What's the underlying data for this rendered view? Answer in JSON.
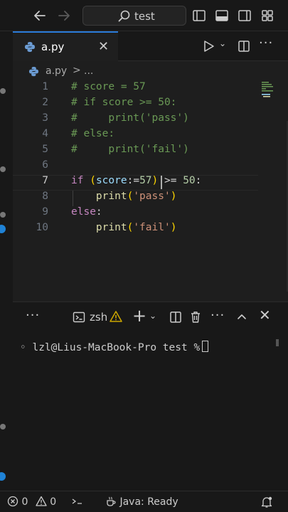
{
  "titlebar": {
    "search_text": "test"
  },
  "tab": {
    "filename": "a.py"
  },
  "breadcrumb": {
    "file": "a.py",
    "separator": ">",
    "more": "..."
  },
  "editor": {
    "active_line": 7,
    "lines": [
      {
        "number": "1",
        "text": "# score = 57"
      },
      {
        "number": "2",
        "text": "# if score >= 50:"
      },
      {
        "number": "3",
        "text": "#     print('pass')"
      },
      {
        "number": "4",
        "text": "# else:"
      },
      {
        "number": "5",
        "text": "#     print('fail')"
      },
      {
        "number": "6",
        "text": ""
      },
      {
        "number": "7",
        "text": "if (score:=57) >= 50:"
      },
      {
        "number": "8",
        "text": "    print('pass')"
      },
      {
        "number": "9",
        "text": "else:"
      },
      {
        "number": "10",
        "text": "    print('fail')"
      }
    ]
  },
  "terminal": {
    "shell_name": "zsh",
    "prompt": "lzl@Lius-MacBook-Pro test %"
  },
  "statusbar": {
    "errors": "0",
    "warnings": "0",
    "java_status": "Java: Ready"
  },
  "colors": {
    "accent": "#2a7ad8",
    "comment": "#6a9955",
    "keyword": "#c586c0",
    "function": "#dcdcaa",
    "string": "#ce9178",
    "number": "#b5cea8",
    "variable": "#9cdcfe",
    "warning": "#cca700"
  }
}
